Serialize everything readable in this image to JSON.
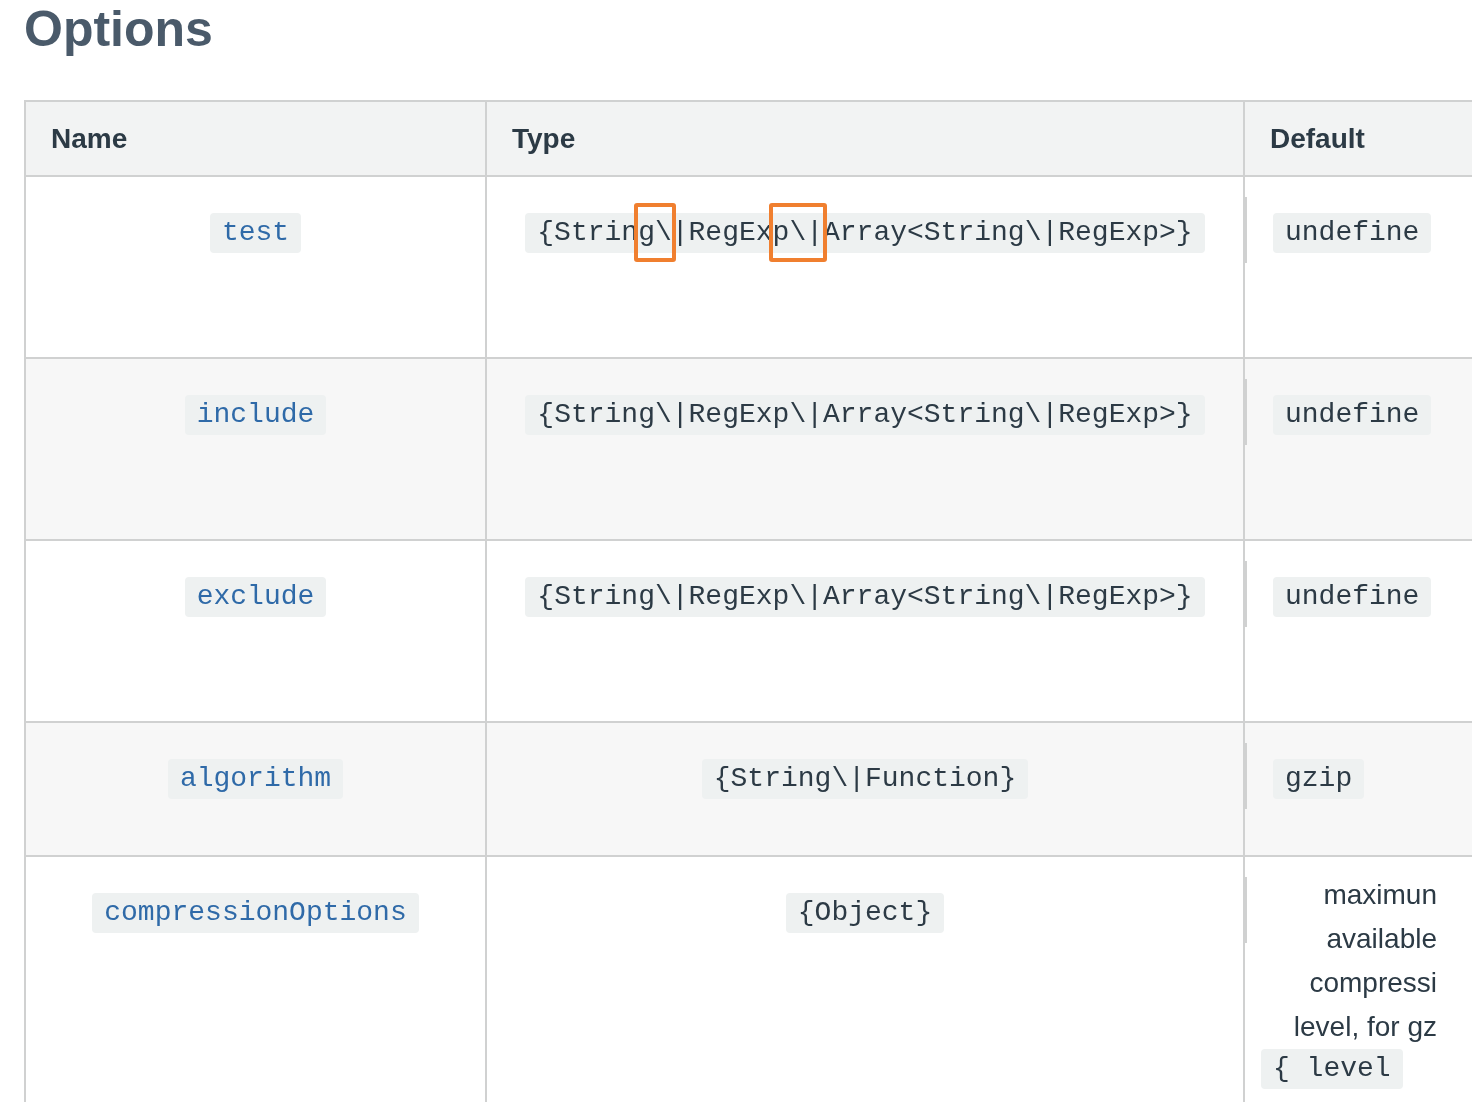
{
  "heading": "Options",
  "table": {
    "columns": [
      "Name",
      "Type",
      "Default"
    ],
    "rows": [
      {
        "name": "test",
        "type": [
          {
            "text": "{Strin",
            "highlighted": false
          },
          {
            "text": "g\\",
            "highlighted": true
          },
          {
            "text": "|RegEx",
            "highlighted": false
          },
          {
            "text": "p\\|",
            "highlighted": true
          },
          {
            "text": "Array<String\\|RegExp>}",
            "highlighted": false
          }
        ],
        "default": {
          "kind": "code",
          "lines": [
            "undefine"
          ]
        }
      },
      {
        "name": "include",
        "type": [
          {
            "text": "{String\\|RegExp\\|Array<String\\|RegExp>}",
            "highlighted": false
          }
        ],
        "default": {
          "kind": "code",
          "lines": [
            "undefine"
          ]
        }
      },
      {
        "name": "exclude",
        "type": [
          {
            "text": "{String\\|RegExp\\|Array<String\\|RegExp>}",
            "highlighted": false
          }
        ],
        "default": {
          "kind": "code",
          "lines": [
            "undefine"
          ]
        }
      },
      {
        "name": "algorithm",
        "type": [
          {
            "text": "{String\\|Function}",
            "highlighted": false
          }
        ],
        "default": {
          "kind": "code",
          "lines": [
            "gzip"
          ]
        }
      },
      {
        "name": "compressionOptions",
        "type": [
          {
            "text": "{Object}",
            "highlighted": false
          }
        ],
        "default": {
          "kind": "text",
          "lines": [
            "maximun",
            "available",
            "compressi",
            "level, for gz"
          ],
          "code": "{ level"
        }
      }
    ]
  }
}
